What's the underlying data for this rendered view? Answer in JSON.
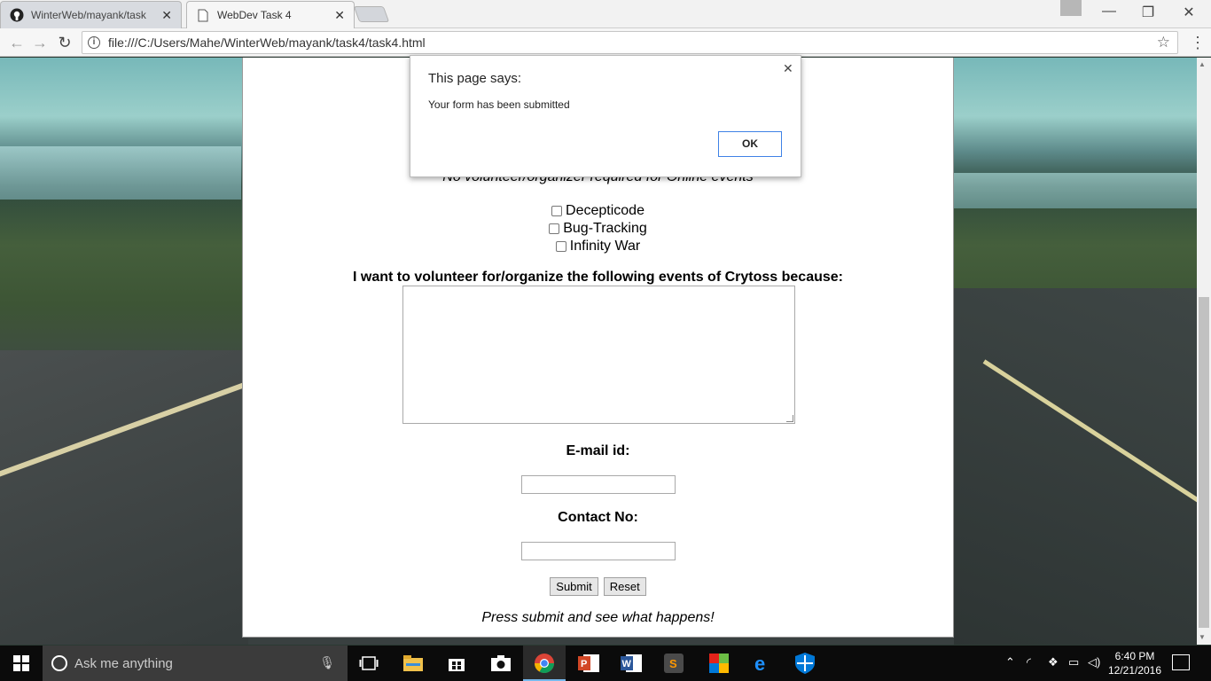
{
  "browser": {
    "tabs": [
      {
        "title": "WinterWeb/mayank/task",
        "icon": "github-icon",
        "active": false
      },
      {
        "title": "WebDev Task 4",
        "icon": "page-icon",
        "active": true
      }
    ],
    "url": "file:///C:/Users/Mahe/WinterWeb/mayank/task4/task4.html",
    "window_controls": {
      "minimize": "—",
      "restore": "❐",
      "close": "✕"
    }
  },
  "page": {
    "partial_note": "No volunteer/organizer required for Online events",
    "events": [
      "Decepticode",
      "Bug-Tracking",
      "Infinity War"
    ],
    "reason_label": "I want to volunteer for/organize the following events of Crytoss because:",
    "email_label": "E-mail id:",
    "contact_label": "Contact No:",
    "submit_label": "Submit",
    "reset_label": "Reset",
    "footnote": "Press submit and see what happens!"
  },
  "dialog": {
    "title": "This page says:",
    "message": "Your form has been submitted",
    "ok_label": "OK"
  },
  "taskbar": {
    "search_placeholder": "Ask me anything",
    "time": "6:40 PM",
    "date": "12/21/2016",
    "apps": [
      "task-view-icon",
      "file-explorer-icon",
      "store-icon",
      "camera-icon",
      "chrome-icon",
      "powerpoint-icon",
      "word-icon",
      "sublime-icon",
      "minecraft-icon",
      "edge-icon",
      "defender-icon"
    ]
  }
}
